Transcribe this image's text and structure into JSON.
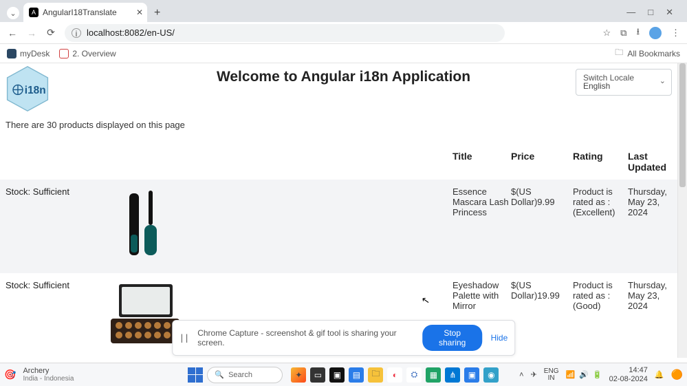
{
  "browser": {
    "tab_title": "AngularI18Translate",
    "url": "localhost:8082/en-US/",
    "bookmarks": {
      "item1": "myDesk",
      "item2": "2. Overview",
      "all": "All Bookmarks"
    }
  },
  "page": {
    "title": "Welcome to Angular i18n Application",
    "logo_text": "i18n",
    "switch_label": "Switch Locale",
    "switch_value": "English",
    "count_line": "There are 30 products displayed on this page"
  },
  "table": {
    "headers": {
      "title": "Title",
      "price": "Price",
      "rating": "Rating",
      "last_updated": "Last Updated"
    },
    "stock_label": "Stock: Sufficient",
    "rows": [
      {
        "title": "Essence Mascara Lash Princess",
        "price": "$(US Dollar)9.99",
        "rating": "Product is rated as : (Excellent)",
        "updated": "Thursday, May 23, 2024"
      },
      {
        "title": "Eyeshadow Palette with Mirror",
        "price": "$(US Dollar)19.99",
        "rating": "Product is rated as : (Good)",
        "updated": "Thursday, May 23, 2024"
      }
    ]
  },
  "share": {
    "text": "Chrome Capture - screenshot & gif tool is sharing your screen.",
    "stop": "Stop sharing",
    "hide": "Hide"
  },
  "taskbar": {
    "profile": "Archery",
    "profile_sub": "India - Indonesia",
    "search": "Search",
    "lang": "ENG",
    "lang_sub": "IN",
    "time": "14:47",
    "date": "02-08-2024"
  }
}
